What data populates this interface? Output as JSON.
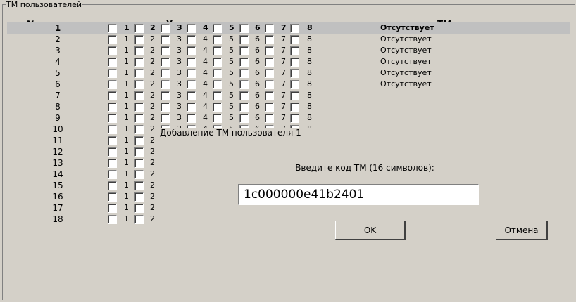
{
  "group_title": "ТМ пользователей",
  "headers": {
    "num": "№ польз.",
    "sections": "Управляет разделами",
    "tm": "ТМ"
  },
  "section_labels": [
    "1",
    "2",
    "3",
    "4",
    "5",
    "6",
    "7",
    "8"
  ],
  "rows": [
    {
      "num": "1",
      "tm": "Отсутствует"
    },
    {
      "num": "2",
      "tm": "Отсутствует"
    },
    {
      "num": "3",
      "tm": "Отсутствует"
    },
    {
      "num": "4",
      "tm": "Отсутствует"
    },
    {
      "num": "5",
      "tm": "Отсутствует"
    },
    {
      "num": "6",
      "tm": "Отсутствует"
    },
    {
      "num": "7"
    },
    {
      "num": "8"
    },
    {
      "num": "9"
    },
    {
      "num": "10"
    },
    {
      "num": "11"
    },
    {
      "num": "12"
    },
    {
      "num": "13"
    },
    {
      "num": "14"
    },
    {
      "num": "15"
    },
    {
      "num": "16"
    },
    {
      "num": "17"
    },
    {
      "num": "18"
    }
  ],
  "dialog": {
    "title": "Добавление ТМ пользователя 1",
    "prompt": "Введите код ТМ  (16 символов):",
    "code_value": "1c000000e41b2401",
    "ok_label": "OK",
    "cancel_label": "Отмена"
  }
}
